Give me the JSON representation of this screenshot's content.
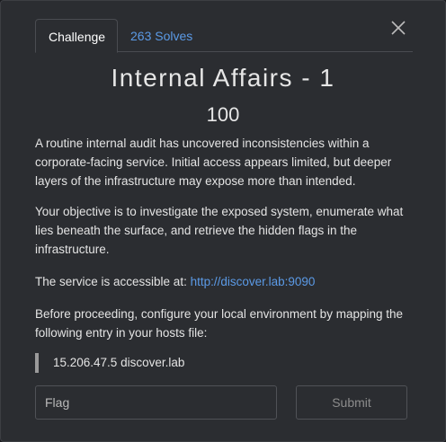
{
  "tabs": {
    "challenge": "Challenge",
    "solves": "263 Solves"
  },
  "challenge": {
    "title": "Internal Affairs - 1",
    "points": "100",
    "description_1": "A routine internal audit has uncovered inconsistencies within a corporate-facing service. Initial access appears limited, but deeper layers of the infrastructure may expose more than intended.",
    "description_2": "Your objective is to investigate the exposed system, enumerate what lies beneath the surface, and retrieve the hidden flags in the infrastructure.",
    "service_label": "The service is accessible at: ",
    "service_url": "http://discover.lab:9090",
    "hosts_instruction": "Before proceeding, configure your local environment by mapping the following entry in your hosts file:",
    "hosts_entry": "15.206.47.5 discover.lab"
  },
  "form": {
    "flag_placeholder": "Flag",
    "submit_label": "Submit"
  },
  "colors": {
    "background": "#2b2d31",
    "link": "#5b9ae6",
    "text": "#e4e4e4"
  },
  "icons": {
    "close": "close-icon"
  }
}
